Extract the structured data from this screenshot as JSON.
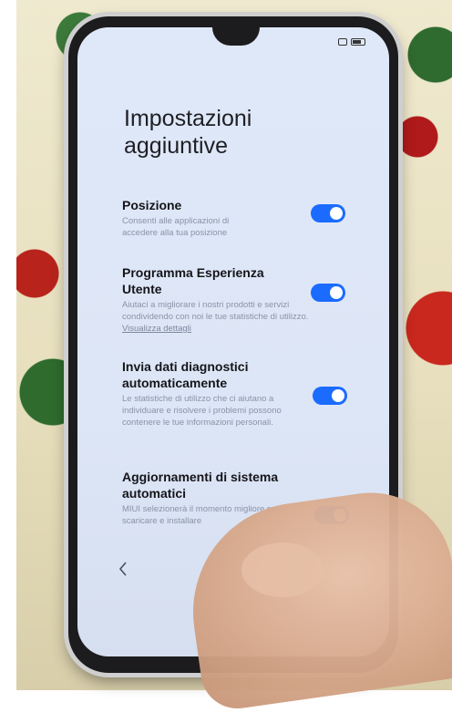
{
  "screen": {
    "title": "Impostazioni aggiuntive"
  },
  "settings": [
    {
      "title": "Posizione",
      "description": "Consenti alle applicazioni di accedere alla tua posizione",
      "enabled": true
    },
    {
      "title": "Programma Esperienza Utente",
      "description": "Aiutaci a migliorare i nostri prodotti e servizi condividendo con noi le tue statistiche di utilizzo.",
      "link": "Visualizza dettagli",
      "enabled": true
    },
    {
      "title": "Invia dati diagnostici automaticamente",
      "description": "Le statistiche di utilizzo che ci aiutano a individuare e risolvere i problemi possono contenere le tue informazioni personali.",
      "enabled": true
    },
    {
      "title": "Aggiornamenti di sistema automatici",
      "description": "MIUI selezionerà il momento migliore per scaricare e installare",
      "enabled": true
    }
  ],
  "navigation": {
    "back_icon": "chevron-left-icon"
  },
  "colors": {
    "toggle_on": "#1b6bff",
    "screen_background": "#dfe8f8"
  }
}
